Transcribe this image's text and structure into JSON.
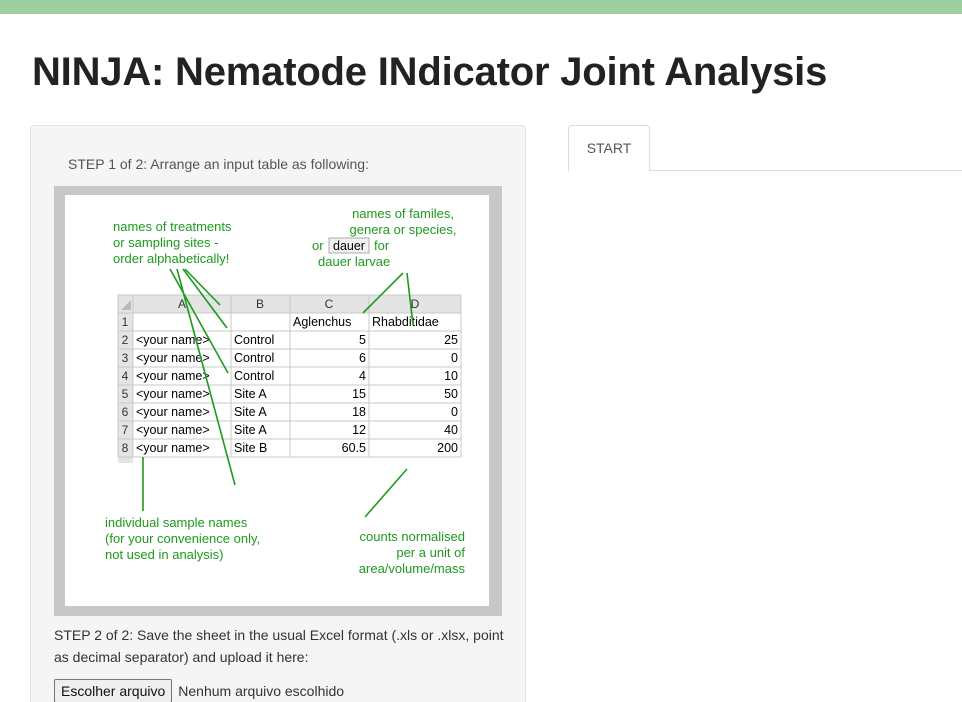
{
  "page_title": "NINJA: Nematode INdicator Joint Analysis",
  "sidebar": {
    "step1": "STEP 1 of 2: Arrange an input table as following:",
    "step2": "STEP 2 of 2: Save the sheet in the usual Excel format (.xls or .xlsx, point as decimal separator) and upload it here:",
    "file_button": "Escolher arquivo",
    "file_status": "Nenhum arquivo escolhido"
  },
  "tabs": [
    {
      "label": "START",
      "active": true
    }
  ],
  "figure": {
    "annotations": {
      "treatments": [
        "names of treatments",
        "or sampling sites -",
        "order alphabetically!"
      ],
      "families": [
        "names of familes,",
        "genera or species,",
        "or",
        "dauer",
        "for",
        "dauer larvae"
      ],
      "samples": [
        "individual sample names",
        "(for your convenience only,",
        "not used in analysis)"
      ],
      "counts": [
        "counts normalised",
        "per a unit of",
        "area/volume/mass"
      ]
    },
    "columns": [
      "A",
      "B",
      "C",
      "D"
    ],
    "row_numbers": [
      "1",
      "2",
      "3",
      "4",
      "5",
      "6",
      "7",
      "8"
    ],
    "header_row": [
      "",
      "",
      "Aglenchus",
      "Rhabditidae"
    ],
    "rows": [
      [
        "<your name>",
        "Control",
        "5",
        "25"
      ],
      [
        "<your name>",
        "Control",
        "6",
        "0"
      ],
      [
        "<your name>",
        "Control",
        "4",
        "10"
      ],
      [
        "<your name>",
        "Site A",
        "15",
        "50"
      ],
      [
        "<your name>",
        "Site A",
        "18",
        "0"
      ],
      [
        "<your name>",
        "Site A",
        "12",
        "40"
      ],
      [
        "<your name>",
        "Site B",
        "60.5",
        "200"
      ]
    ]
  },
  "colors": {
    "topbar": "#9dd09c",
    "annotation": "#1e9a1e",
    "sidebar_bg": "#f5f5f5"
  }
}
